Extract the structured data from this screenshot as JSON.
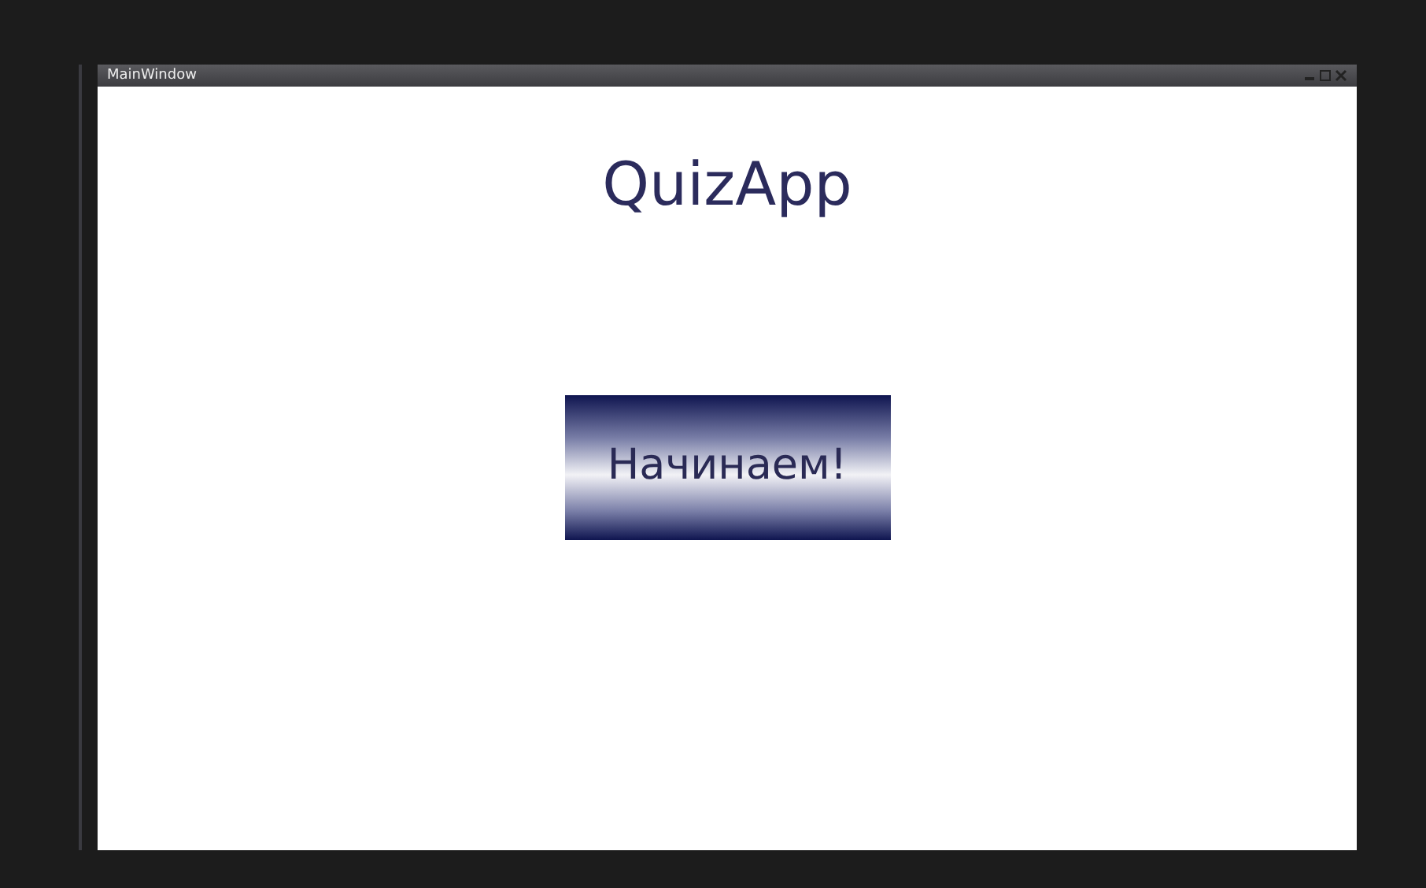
{
  "window": {
    "title": "MainWindow"
  },
  "app_title": "QuizApp",
  "start_button": {
    "label": "Начинаем!"
  }
}
